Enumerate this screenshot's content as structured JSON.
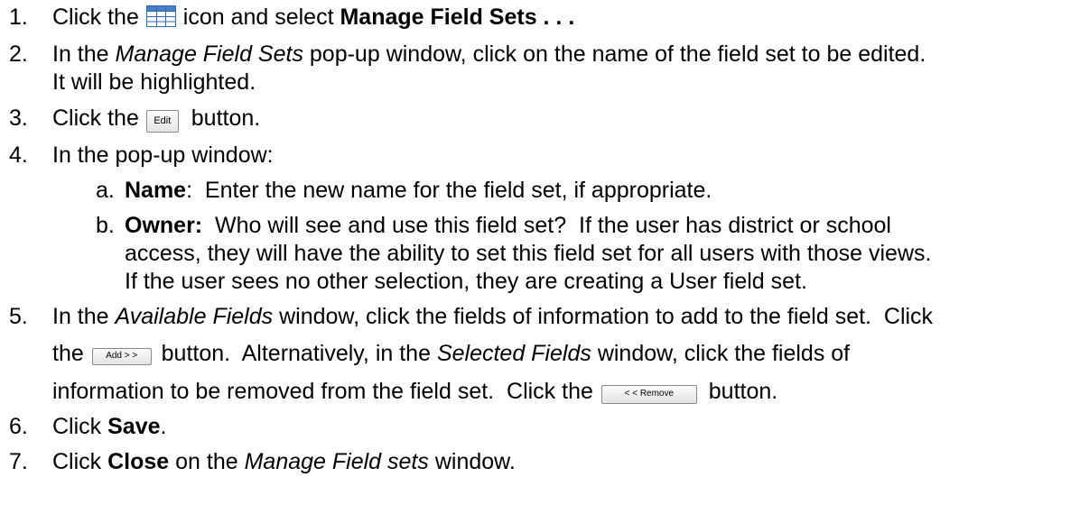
{
  "steps": [
    {
      "num": "1.",
      "parts": {
        "a": "Click the ",
        "b": " icon and select ",
        "c": "Manage Field Sets . . ."
      }
    },
    {
      "num": "2.",
      "parts": {
        "a": "In the ",
        "b": "Manage Field Sets",
        "c": " pop-up window, click on the name of the field set to be edited.",
        "d": "It will be highlighted."
      }
    },
    {
      "num": "3.",
      "parts": {
        "a": "Click the ",
        "b": " button."
      }
    },
    {
      "num": "4.",
      "parts": {
        "a": "In the pop-up window:"
      }
    },
    {
      "num": "5.",
      "parts": {
        "a": "In the ",
        "b": "Available Fields",
        "c": " window, click the fields of information to add to the field set.  Click",
        "d": "the ",
        "e": " button.  Alternatively, in the ",
        "f": "Selected Fields",
        "g": " window, click the fields of",
        "h": "information to be removed from the field set.  Click the ",
        "i": " button."
      }
    },
    {
      "num": "6.",
      "parts": {
        "a": "Click ",
        "b": "Save",
        "c": "."
      }
    },
    {
      "num": "7.",
      "parts": {
        "a": "Click ",
        "b": "Close",
        "c": " on the ",
        "d": "Manage Field sets",
        "e": " window."
      }
    }
  ],
  "substeps": [
    {
      "letter": "a.",
      "label": "Name",
      "text": ":  Enter the new name for the field set, if appropriate."
    },
    {
      "letter": "b.",
      "label": "Owner:",
      "text": "  Who will see and use this field set?  If the user has district or school",
      "line2": "access, they will have the ability to set this field set for all users with those views.",
      "line3": "If the user sees no other selection, they are creating a User field set."
    }
  ],
  "buttons": {
    "edit": "Edit",
    "add": "Add > >",
    "remove": "< < Remove"
  },
  "icons": {
    "grid": "grid-table-icon"
  },
  "colors": {
    "grid_icon_header": "#4a7fc1",
    "grid_icon_cell": "#ffffff",
    "grid_icon_border": "#2e6bb5"
  }
}
